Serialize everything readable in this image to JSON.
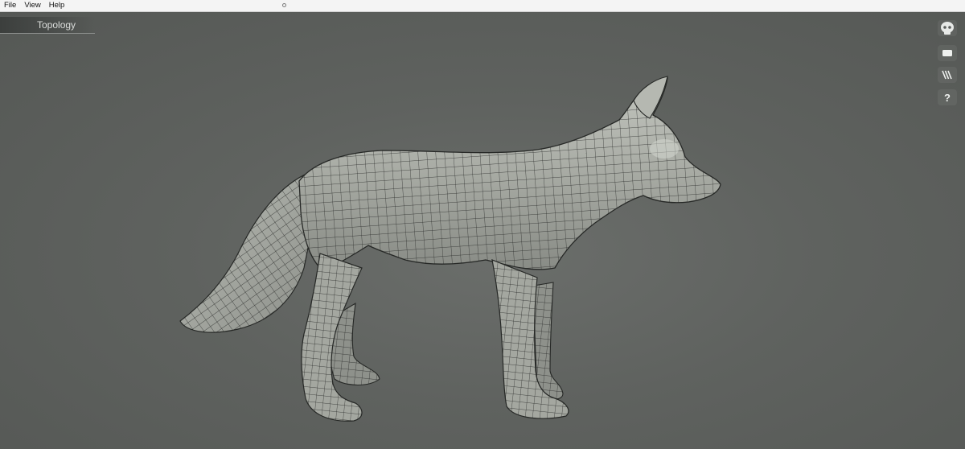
{
  "menubar": {
    "items": [
      {
        "label": "File"
      },
      {
        "label": "View"
      },
      {
        "label": "Help"
      }
    ]
  },
  "viewport": {
    "mode_tab": {
      "label": "Topology"
    },
    "toolbar": {
      "help_label": "?",
      "icons": [
        "skull-icon",
        "rectangle-icon",
        "stripes-icon",
        "help-icon"
      ]
    },
    "model": {
      "subject": "fox",
      "display": "wireframe-over-shaded"
    }
  },
  "colors": {
    "menubar_bg": "#f4f4f4",
    "viewport_bg": "#5f625f",
    "mesh_fill": "#a9aca5",
    "mesh_wire": "#262826"
  }
}
